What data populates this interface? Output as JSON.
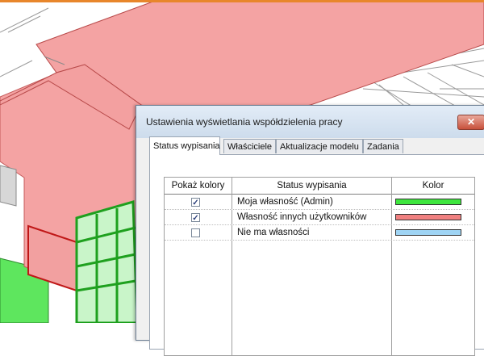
{
  "dialog": {
    "title": "Ustawienia wyświetlania współdzielenia pracy",
    "close_label": "✕"
  },
  "tabs": [
    {
      "label": "Status wypisania",
      "active": true
    },
    {
      "label": "Właściciele",
      "active": false
    },
    {
      "label": "Aktualizacje modelu",
      "active": false
    },
    {
      "label": "Zadania",
      "active": false
    }
  ],
  "table": {
    "headers": {
      "show_colors": "Pokaż kolory",
      "status": "Status wypisania",
      "color": "Kolor"
    },
    "rows": [
      {
        "checked": true,
        "check_mark": "✓",
        "status": "Moja własność (Admin)",
        "color": "#3ee63e"
      },
      {
        "checked": true,
        "check_mark": "✓",
        "status": "Własność innych użytkowników",
        "color": "#f08080"
      },
      {
        "checked": false,
        "check_mark": "",
        "status": "Nie ma własności",
        "color": "#9fd4f4"
      }
    ]
  },
  "model_colors": {
    "roof": "#f4a3a3",
    "walls": "#f5a0a0",
    "green": "#3ad93a",
    "accent_line": "#e8862b"
  }
}
